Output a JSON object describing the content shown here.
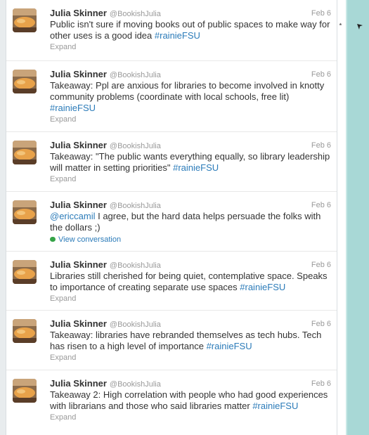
{
  "tweets": [
    {
      "name": "Julia Skinner",
      "handle": "@BookishJulia",
      "time": "Feb 6",
      "parts": [
        "Public isn't sure if moving books out of public spaces to make way for other uses is a good idea ",
        "#rainieFSU"
      ],
      "action": "Expand"
    },
    {
      "name": "Julia Skinner",
      "handle": "@BookishJulia",
      "time": "Feb 6",
      "parts": [
        "Takeaway: Ppl are anxious for libraries to become involved in knotty community problems (coordinate with local schools, free lit) ",
        "#rainieFSU"
      ],
      "action": "Expand"
    },
    {
      "name": "Julia Skinner",
      "handle": "@BookishJulia",
      "time": "Feb 6",
      "parts": [
        "Takeaway: \"The public wants everything equally, so library leadership will matter in setting priorities\" ",
        "#rainieFSU"
      ],
      "action": "Expand"
    },
    {
      "name": "Julia Skinner",
      "handle": "@BookishJulia",
      "time": "Feb 6",
      "mention": "@ericcamil",
      "text_after_mention": " I agree, but the hard data helps persuade the folks with the dollars ;)",
      "action": "View conversation"
    },
    {
      "name": "Julia Skinner",
      "handle": "@BookishJulia",
      "time": "Feb 6",
      "parts": [
        "Libraries still cherished for being quiet, contemplative space. Speaks to importance of creating separate use spaces ",
        "#rainieFSU"
      ],
      "action": "Expand"
    },
    {
      "name": "Julia Skinner",
      "handle": "@BookishJulia",
      "time": "Feb 6",
      "parts": [
        "Takeaway: libraries have rebranded themselves as tech hubs. Tech has risen to a high level of importance ",
        "#rainieFSU"
      ],
      "action": "Expand"
    },
    {
      "name": "Julia Skinner",
      "handle": "@BookishJulia",
      "time": "Feb 6",
      "parts": [
        "Takeaway 2: High correlation with people who had good experiences with librarians and those who said libraries matter ",
        "#rainieFSU"
      ],
      "action": "Expand"
    }
  ],
  "colors": {
    "link": "#2b7bb9",
    "muted": "#999999",
    "sidebar": "#a8d8d6",
    "conversation_icon": "#35a347"
  }
}
